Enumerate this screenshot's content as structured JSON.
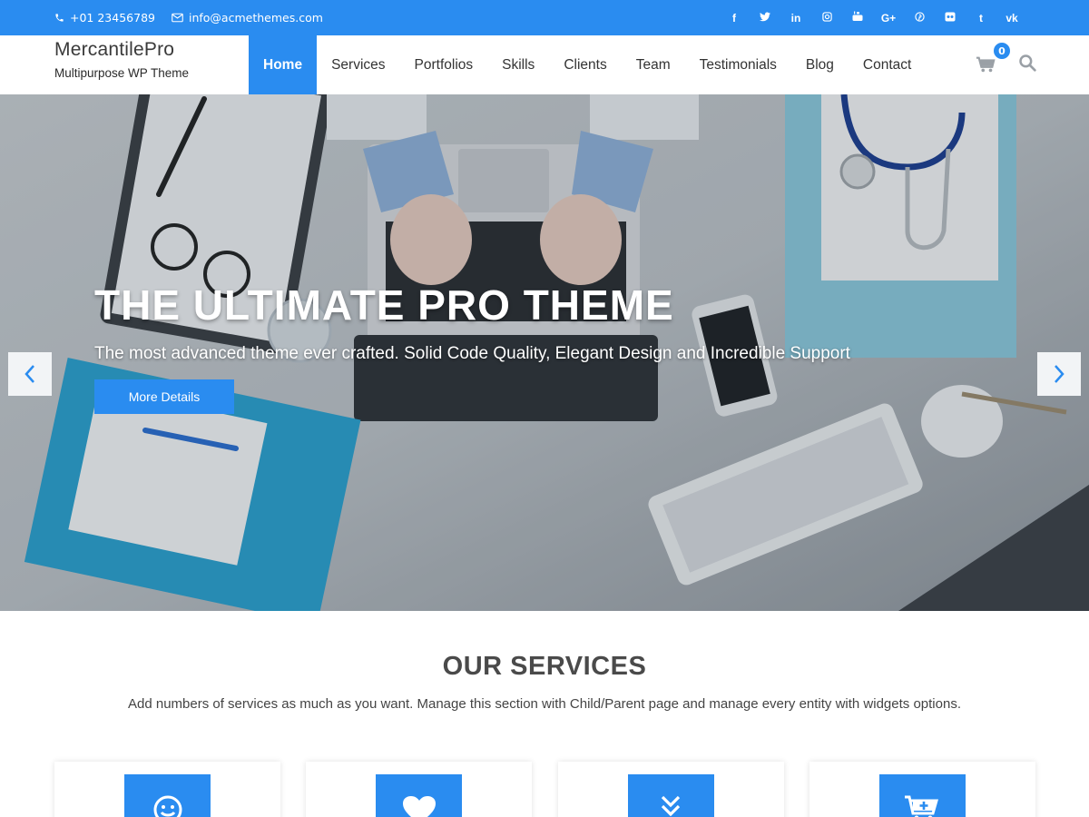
{
  "topbar": {
    "phone": "+01 23456789",
    "email": "info@acmethemes.com",
    "socials": [
      "f",
      "t",
      "in",
      "ig",
      "yt",
      "G+",
      "p",
      "fl",
      "t",
      "vk"
    ]
  },
  "brand": {
    "title": "MercantilePro",
    "tagline": "Multipurpose WP Theme"
  },
  "nav": {
    "items": [
      {
        "label": "Home",
        "active": true
      },
      {
        "label": "Services"
      },
      {
        "label": "Portfolios"
      },
      {
        "label": "Skills"
      },
      {
        "label": "Clients"
      },
      {
        "label": "Team"
      },
      {
        "label": "Testimonials"
      },
      {
        "label": "Blog"
      },
      {
        "label": "Contact"
      }
    ],
    "cart_count": "0"
  },
  "hero": {
    "title": "THE ULTIMATE PRO THEME",
    "subtitle": "The most advanced theme ever crafted. Solid Code Quality, Elegant Design and Incredible Support",
    "button": "More Details"
  },
  "services": {
    "title": "OUR SERVICES",
    "description": "Add numbers of services as much as you want. Manage this section with Child/Parent page and manage every entity with widgets options.",
    "cards": [
      {
        "icon": "smile-icon"
      },
      {
        "icon": "heart-icon"
      },
      {
        "icon": "double-chevron-down-icon"
      },
      {
        "icon": "cart-plus-icon"
      }
    ]
  },
  "colors": {
    "accent": "#2a8cf0",
    "topbar": "#2a8cf0",
    "heading": "#4a4a4a"
  }
}
